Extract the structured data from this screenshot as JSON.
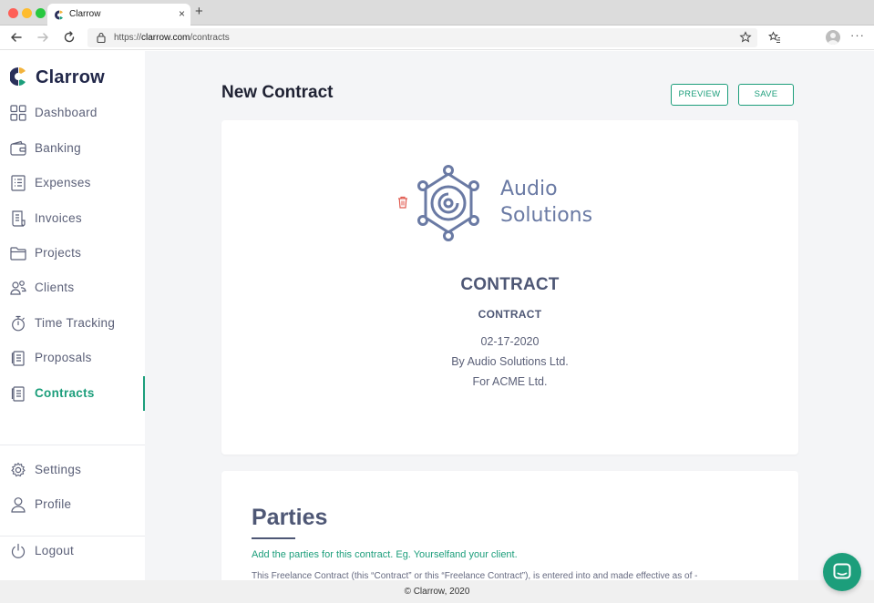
{
  "browser": {
    "tab_title": "Clarrow",
    "url_prefix": "https://",
    "url_domain": "clarrow.com",
    "url_path": "/contracts",
    "close_glyph": "×",
    "new_tab_glyph": "+",
    "more_glyph": "···"
  },
  "app": {
    "brand": "Clarrow",
    "accent_color": "#1c9e7b"
  },
  "sidebar": {
    "items": [
      {
        "label": "Dashboard",
        "icon": "dashboard-icon"
      },
      {
        "label": "Banking",
        "icon": "wallet-icon"
      },
      {
        "label": "Expenses",
        "icon": "receipt-icon"
      },
      {
        "label": "Invoices",
        "icon": "invoice-icon"
      },
      {
        "label": "Projects",
        "icon": "folder-icon"
      },
      {
        "label": "Clients",
        "icon": "users-icon"
      },
      {
        "label": "Time Tracking",
        "icon": "stopwatch-icon"
      },
      {
        "label": "Proposals",
        "icon": "document-icon"
      },
      {
        "label": "Contracts",
        "icon": "document-icon",
        "active": true
      }
    ],
    "settings": "Settings",
    "profile": "Profile",
    "logout": "Logout"
  },
  "header": {
    "title": "New Contract",
    "preview_label": "PREVIEW",
    "save_label": "SAVE"
  },
  "contract": {
    "company_logo_line1": "Audio",
    "company_logo_line2": "Solutions",
    "title": "CONTRACT",
    "subtitle": "CONTRACT",
    "date": "02-17-2020",
    "by_line": "By Audio Solutions Ltd.",
    "for_line": "For ACME Ltd."
  },
  "parties": {
    "heading": "Parties",
    "hint": "Add the parties for this contract. Eg. Yourselfand your client.",
    "body": "This Freelance Contract (this “Contract” or this “Freelance Contract”), is entered into and made effective as of -"
  },
  "footer": {
    "text": "© Clarrow, 2020"
  }
}
